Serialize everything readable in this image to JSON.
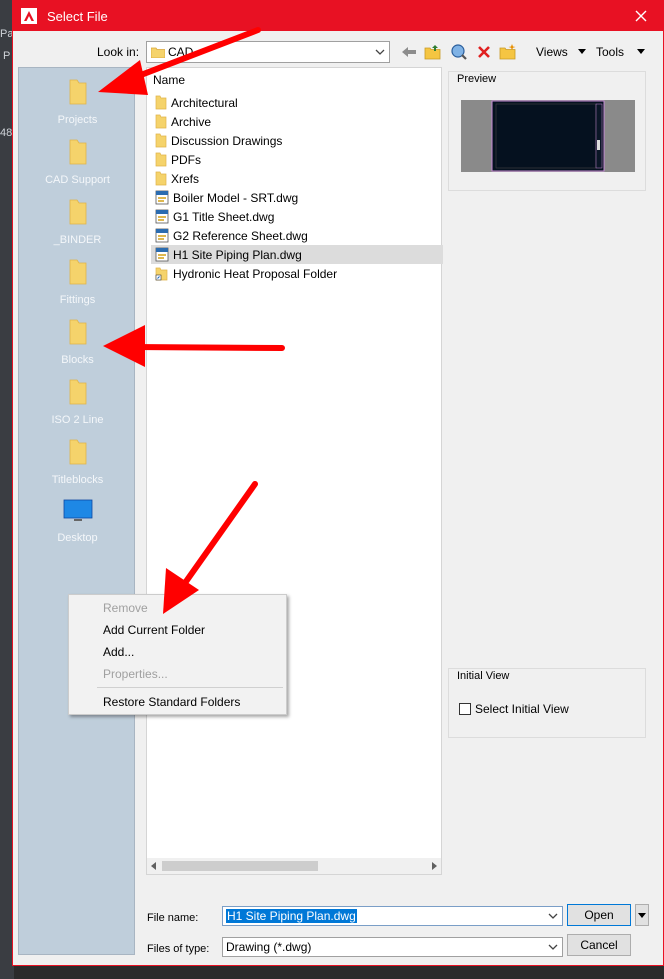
{
  "window": {
    "title": "Select File"
  },
  "background": {
    "frag1": "Par",
    "frag2": "P",
    "frag3": "48"
  },
  "toolbar": {
    "look_in_label": "Look in:",
    "look_in_value": "CAD",
    "views_label": "Views",
    "tools_label": "Tools"
  },
  "places": [
    {
      "label": "Projects",
      "icon": "folder-icon"
    },
    {
      "label": "CAD Support",
      "icon": "folder-icon"
    },
    {
      "label": "_BINDER",
      "icon": "folder-icon"
    },
    {
      "label": "Fittings",
      "icon": "folder-icon"
    },
    {
      "label": "Blocks",
      "icon": "folder-icon"
    },
    {
      "label": "ISO 2 Line",
      "icon": "folder-icon"
    },
    {
      "label": "Titleblocks",
      "icon": "folder-icon"
    },
    {
      "label": "Desktop",
      "icon": "desktop-icon"
    }
  ],
  "file_list": {
    "column_header": "Name",
    "items": [
      {
        "name": "Architectural",
        "type": "folder"
      },
      {
        "name": "Archive",
        "type": "folder"
      },
      {
        "name": "Discussion Drawings",
        "type": "folder"
      },
      {
        "name": "PDFs",
        "type": "folder"
      },
      {
        "name": "Xrefs",
        "type": "folder"
      },
      {
        "name": "Boiler Model - SRT.dwg",
        "type": "dwg"
      },
      {
        "name": "G1 Title Sheet.dwg",
        "type": "dwg"
      },
      {
        "name": "G2 Reference Sheet.dwg",
        "type": "dwg"
      },
      {
        "name": "H1 Site Piping Plan.dwg",
        "type": "dwg",
        "selected": true
      },
      {
        "name": "Hydronic Heat Proposal Folder",
        "type": "shortcut"
      }
    ]
  },
  "preview": {
    "label": "Preview"
  },
  "initial_view": {
    "group_label": "Initial View",
    "checkbox_label": "Select Initial View",
    "checked": false
  },
  "bottom": {
    "file_name_label": "File name:",
    "file_name_value": "H1 Site Piping Plan.dwg",
    "file_type_label": "Files of type:",
    "file_type_value": "Drawing (*.dwg)",
    "open_label": "Open",
    "cancel_label": "Cancel"
  },
  "context_menu": {
    "items": [
      {
        "label": "Remove",
        "enabled": false
      },
      {
        "label": "Add Current Folder",
        "enabled": true
      },
      {
        "label": "Add...",
        "enabled": true
      },
      {
        "label": "Properties...",
        "enabled": false
      },
      {
        "label": "Restore Standard Folders",
        "enabled": true
      }
    ]
  },
  "colors": {
    "accent": "#e81123",
    "selection": "#0078d7",
    "places_bg": "#bfcedb",
    "annotation_arrow": "#ff0000"
  }
}
